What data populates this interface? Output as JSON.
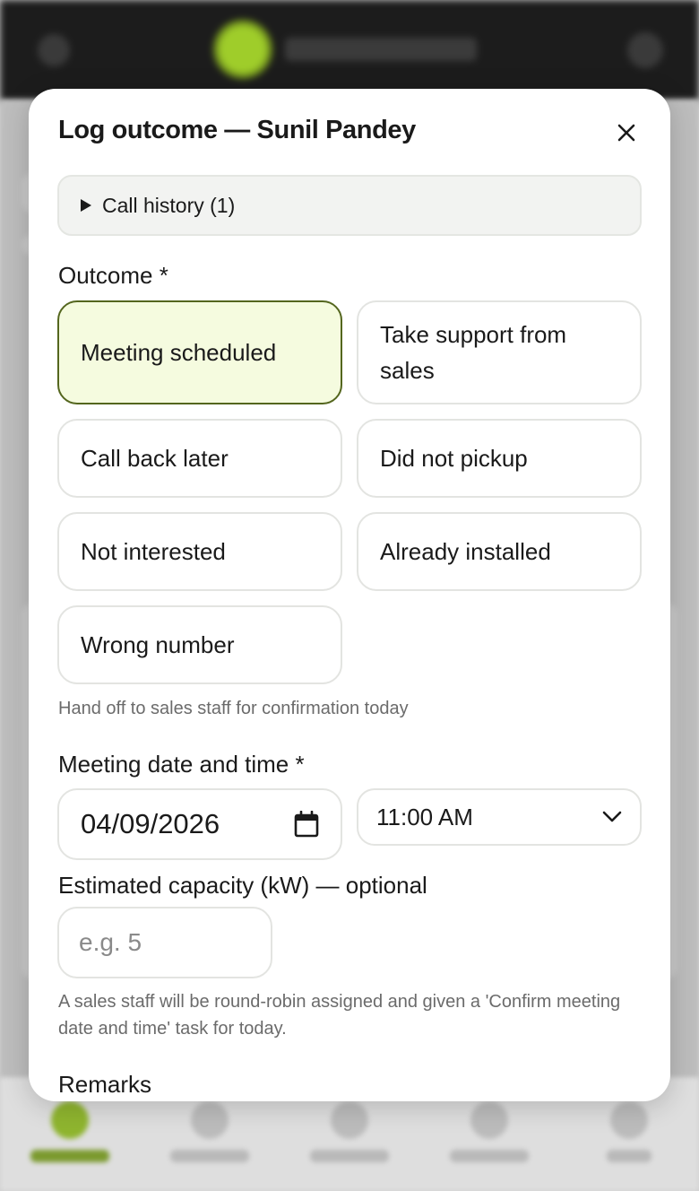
{
  "modal": {
    "title": "Log outcome — Sunil Pandey",
    "close_icon": "close-icon"
  },
  "history": {
    "label": "Call history (1)",
    "icon": "triangle-right-icon"
  },
  "outcome": {
    "label": "Outcome *",
    "options": [
      {
        "label": "Meeting scheduled",
        "selected": true
      },
      {
        "label": "Take support from sales",
        "selected": false
      },
      {
        "label": "Call back later",
        "selected": false
      },
      {
        "label": "Did not pickup",
        "selected": false
      },
      {
        "label": "Not interested",
        "selected": false
      },
      {
        "label": "Already installed",
        "selected": false
      },
      {
        "label": "Wrong number",
        "selected": false
      }
    ],
    "hint": "Hand off to sales staff for confirmation today"
  },
  "meeting": {
    "label": "Meeting date and time *",
    "date_value": "04/09/2026",
    "date_icon": "calendar-icon",
    "time_value": "11:00 AM",
    "time_icon": "chevron-down-icon"
  },
  "capacity": {
    "label": "Estimated capacity (kW) — optional",
    "placeholder": "e.g. 5",
    "value": ""
  },
  "info": "A sales staff will be round-robin assigned and given a 'Confirm meeting date and time' task for today.",
  "remarks": {
    "label": "Remarks"
  },
  "colors": {
    "selected_bg": "#f5fbdf",
    "selected_border": "#54661e",
    "brand_accent": "#9fcd2a"
  }
}
